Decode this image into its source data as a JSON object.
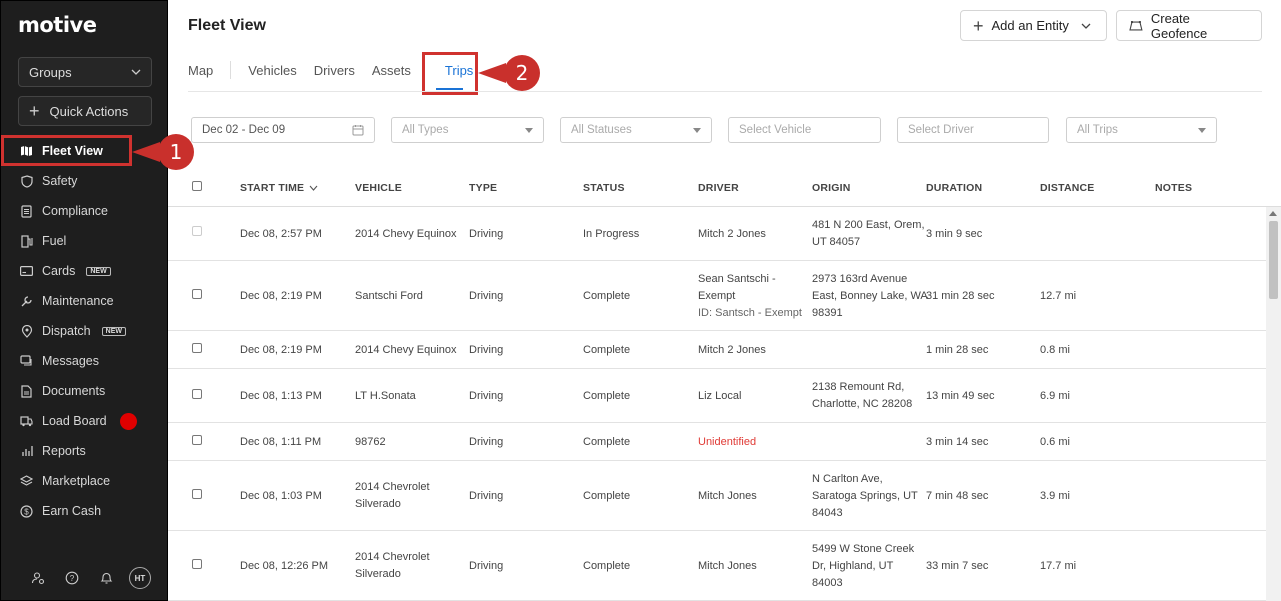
{
  "app": {
    "logo": "motive"
  },
  "sidebar": {
    "groups_label": "Groups",
    "quick_actions_label": "Quick Actions",
    "items": [
      {
        "label": "Fleet View",
        "icon": "map-icon",
        "badge": ""
      },
      {
        "label": "Safety",
        "icon": "shield-icon",
        "badge": ""
      },
      {
        "label": "Compliance",
        "icon": "document-list-icon",
        "badge": ""
      },
      {
        "label": "Fuel",
        "icon": "fuel-pump-icon",
        "badge": ""
      },
      {
        "label": "Cards",
        "icon": "card-icon",
        "badge": "NEW"
      },
      {
        "label": "Maintenance",
        "icon": "wrench-icon",
        "badge": ""
      },
      {
        "label": "Dispatch",
        "icon": "location-pin-icon",
        "badge": "NEW"
      },
      {
        "label": "Messages",
        "icon": "chat-icon",
        "badge": ""
      },
      {
        "label": "Documents",
        "icon": "file-icon",
        "badge": ""
      },
      {
        "label": "Load Board",
        "icon": "truck-icon",
        "badge": ""
      },
      {
        "label": "Reports",
        "icon": "bar-chart-icon",
        "badge": ""
      },
      {
        "label": "Marketplace",
        "icon": "layers-icon",
        "badge": ""
      },
      {
        "label": "Earn Cash",
        "icon": "dollar-icon",
        "badge": ""
      }
    ],
    "avatar_initials": "HT"
  },
  "callouts": {
    "one": "1",
    "two": "2"
  },
  "header": {
    "title": "Fleet View",
    "add_entity_label": "Add an Entity",
    "create_geofence_label": "Create Geofence"
  },
  "tabs": [
    "Map",
    "Vehicles",
    "Drivers",
    "Assets",
    "Trips"
  ],
  "filters": {
    "date_range": "Dec 02 - Dec 09",
    "types": "All Types",
    "statuses": "All Statuses",
    "vehicle": "Select Vehicle",
    "driver": "Select Driver",
    "trips": "All Trips"
  },
  "table": {
    "columns": [
      "START TIME",
      "VEHICLE",
      "TYPE",
      "STATUS",
      "DRIVER",
      "ORIGIN",
      "DURATION",
      "DISTANCE",
      "NOTES"
    ],
    "rows": [
      {
        "start": "Dec 08, 2:57 PM",
        "vehicle": [
          "2014 Chevy Equinox"
        ],
        "type": "Driving",
        "status": "In Progress",
        "driver": [
          "Mitch 2 Jones"
        ],
        "origin": [
          "481 N 200 East, Orem,",
          "UT 84057"
        ],
        "duration": "3 min 9 sec",
        "distance": ""
      },
      {
        "start": "Dec 08, 2:19 PM",
        "vehicle": [
          "Santschi Ford"
        ],
        "type": "Driving",
        "status": "Complete",
        "driver": [
          "Sean Santschi -",
          "Exempt",
          "ID: Santsch - Exempt"
        ],
        "origin": [
          "2973 163rd Avenue",
          "East, Bonney Lake, WA",
          "98391"
        ],
        "duration": "31 min 28 sec",
        "distance": "12.7 mi"
      },
      {
        "start": "Dec 08, 2:19 PM",
        "vehicle": [
          "2014 Chevy Equinox"
        ],
        "type": "Driving",
        "status": "Complete",
        "driver": [
          "Mitch 2 Jones"
        ],
        "origin": [],
        "duration": "1 min 28 sec",
        "distance": "0.8 mi"
      },
      {
        "start": "Dec 08, 1:13 PM",
        "vehicle": [
          "LT H.Sonata"
        ],
        "type": "Driving",
        "status": "Complete",
        "driver": [
          "Liz Local"
        ],
        "origin": [
          "2138 Remount Rd,",
          "Charlotte, NC 28208"
        ],
        "duration": "13 min 49 sec",
        "distance": "6.9 mi"
      },
      {
        "start": "Dec 08, 1:11 PM",
        "vehicle": [
          "98762"
        ],
        "type": "Driving",
        "status": "Complete",
        "driver": [
          "Unidentified"
        ],
        "origin": [],
        "duration": "3 min 14 sec",
        "distance": "0.6 mi"
      },
      {
        "start": "Dec 08, 1:03 PM",
        "vehicle": [
          "2014 Chevrolet",
          "Silverado"
        ],
        "type": "Driving",
        "status": "Complete",
        "driver": [
          "Mitch Jones"
        ],
        "origin": [
          "N Carlton Ave,",
          "Saratoga Springs, UT",
          "84043"
        ],
        "duration": "7 min 48 sec",
        "distance": "3.9 mi"
      },
      {
        "start": "Dec 08, 12:26 PM",
        "vehicle": [
          "2014 Chevrolet",
          "Silverado"
        ],
        "type": "Driving",
        "status": "Complete",
        "driver": [
          "Mitch Jones"
        ],
        "origin": [
          "5499 W Stone Creek",
          "Dr, Highland, UT",
          "84003"
        ],
        "duration": "33 min 7 sec",
        "distance": "17.7 mi"
      }
    ]
  },
  "colors": {
    "accent": "#1a73d6",
    "callout": "#c9302c",
    "sidebar": "#1e1e1e",
    "unidentified": "#e03a35"
  }
}
